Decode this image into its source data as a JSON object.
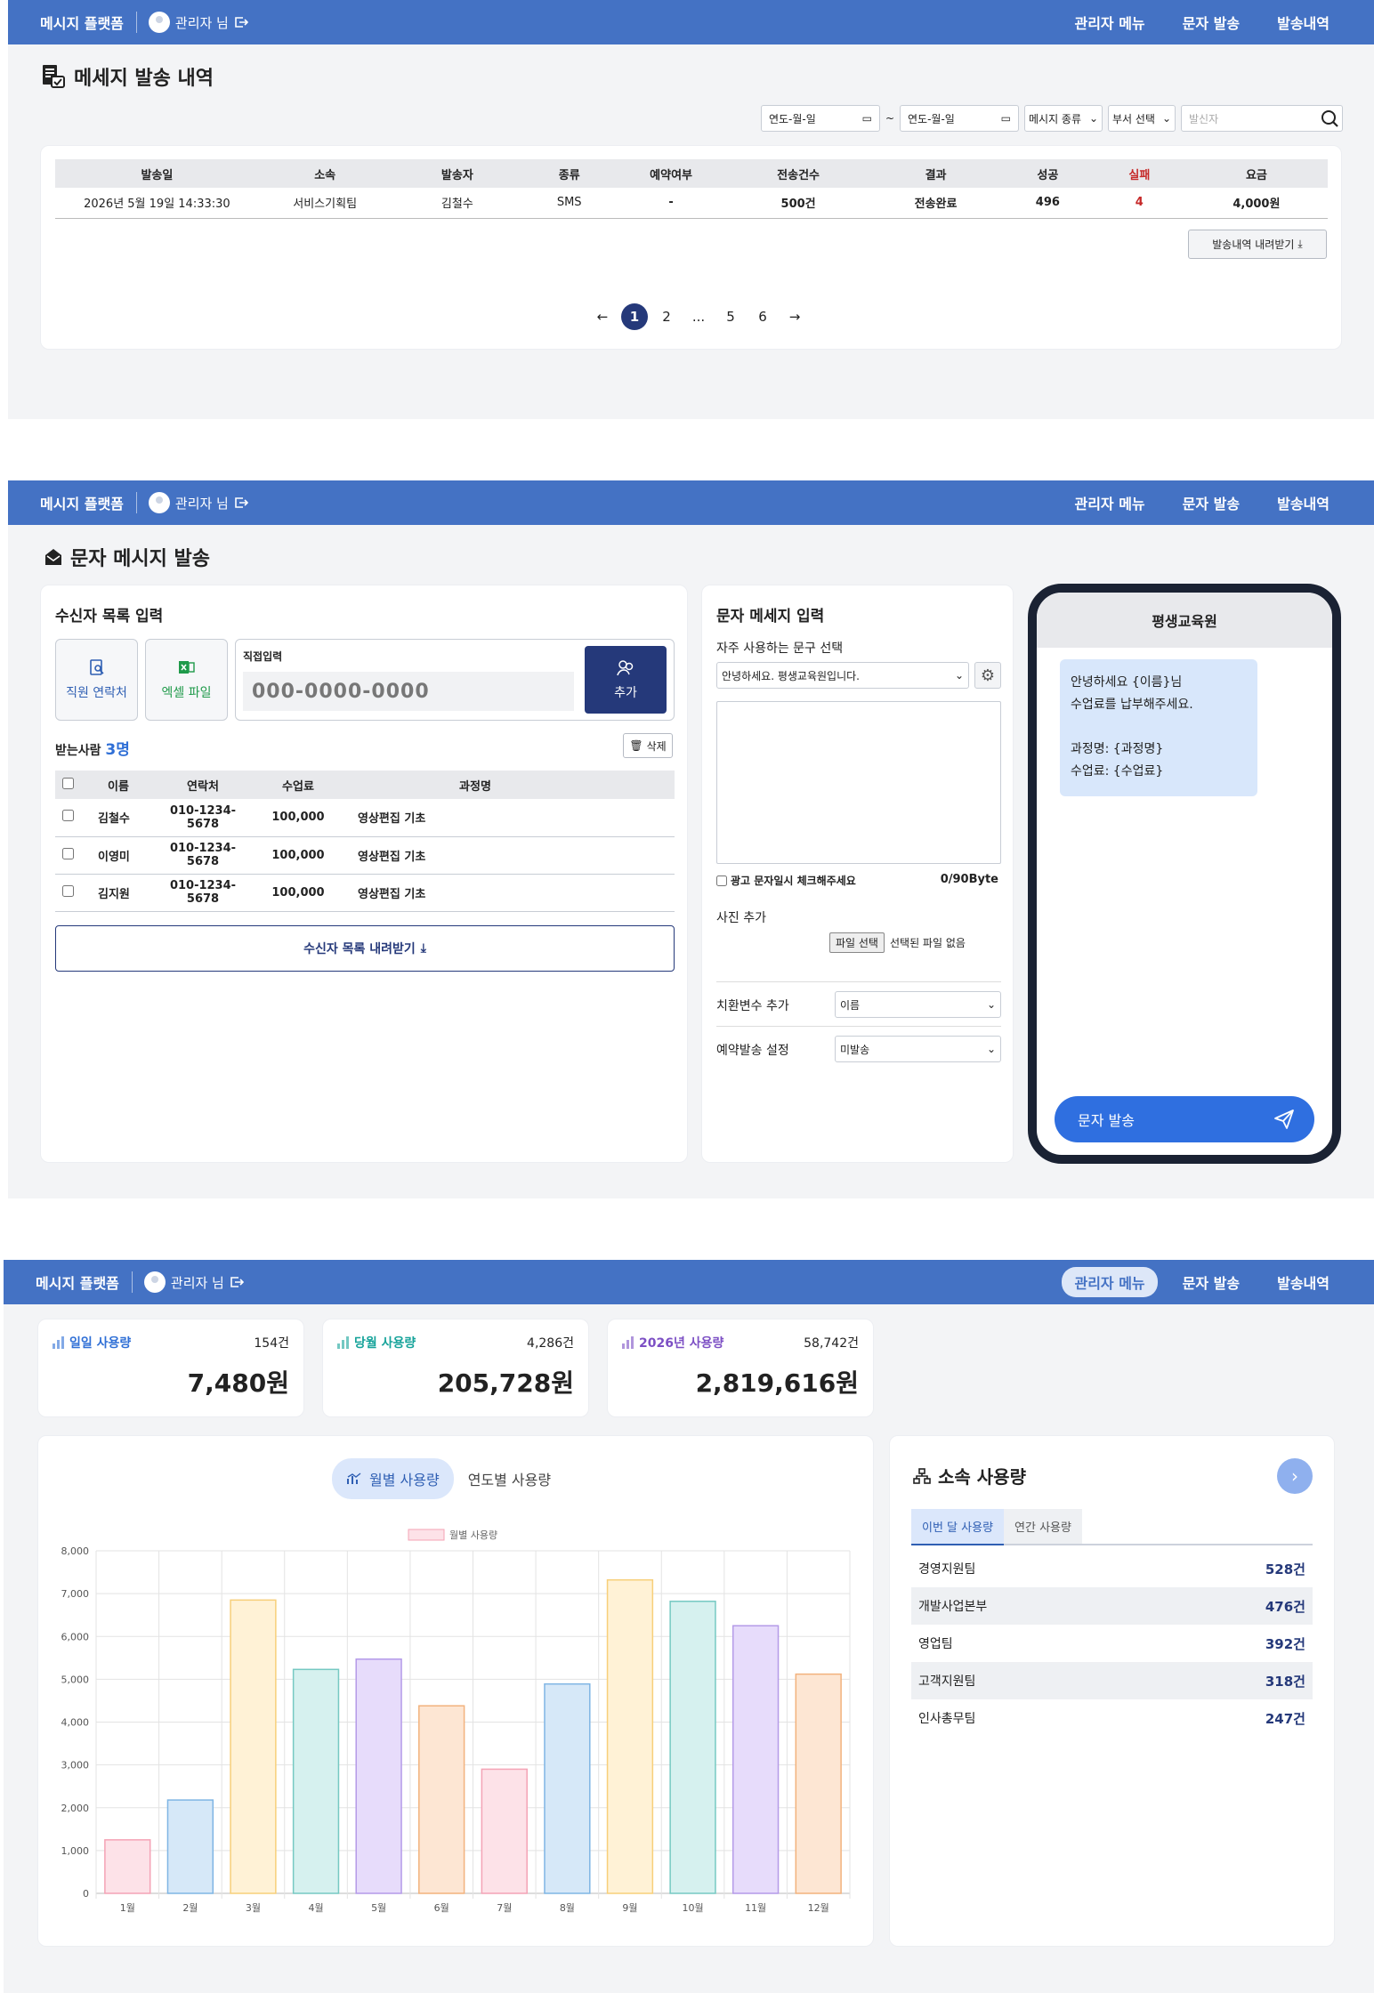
{
  "nav": {
    "logo": "메시지 플랫폼",
    "user": "관리자 님",
    "menu": [
      "관리자 메뉴",
      "문자 발송",
      "발송내역"
    ]
  },
  "history": {
    "title": "메세지 발송 내역",
    "filter": {
      "date_from": "연도-월-일",
      "tilde": "~",
      "date_to": "연도-월-일",
      "type_select": "메시지 종류",
      "dept_select": "부서 선택",
      "sender_placeholder": "발신자"
    },
    "columns": [
      "발송일",
      "소속",
      "발송자",
      "종류",
      "예약여부",
      "전송건수",
      "결과",
      "성공",
      "실패",
      "요금"
    ],
    "rows": [
      [
        "2026년 5월 19일 14:33:30",
        "서비스기획팀",
        "김철수",
        "SMS",
        "-",
        "500건",
        "전송완료",
        "496",
        "4",
        "4,000원"
      ]
    ],
    "download_label": "발송내역 내려받기",
    "pages": [
      "1",
      "2",
      "...",
      "5",
      "6"
    ]
  },
  "send": {
    "title": "문자 메시지 발송",
    "recipients": {
      "title": "수신자 목록 입력",
      "staff_btn": "직원 연락처",
      "excel_btn": "엑셀 파일",
      "direct_label": "직접입력",
      "direct_placeholder": "000-0000-0000",
      "add_btn": "추가",
      "count_label": "받는사람",
      "count": "3명",
      "delete_btn": "삭제",
      "columns": [
        "이름",
        "연락처",
        "수업료",
        "과정명"
      ],
      "rows": [
        [
          "김철수",
          "010-1234-5678",
          "100,000",
          "영상편집 기초"
        ],
        [
          "이영미",
          "010-1234-5678",
          "100,000",
          "영상편집 기초"
        ],
        [
          "김지원",
          "010-1234-5678",
          "100,000",
          "영상편집 기초"
        ]
      ],
      "download_btn": "수신자 목록 내려받기"
    },
    "message": {
      "title": "문자 메세지 입력",
      "phrase_label": "자주 사용하는 문구 선택",
      "phrase_value": "안녕하세요. 평생교육원입니다.",
      "ad_check": "광고 문자일시 체크해주세요",
      "bytes": "0/90Byte",
      "photo_label": "사진 추가",
      "file_btn": "파일 선택",
      "file_none": "선택된 파일 없음",
      "var_label": "치환변수 추가",
      "var_value": "이름",
      "reserve_label": "예약발송 설정",
      "reserve_value": "미발송"
    },
    "phone": {
      "header": "평생교육원",
      "bubble": [
        "안녕하세요 {이름}님",
        "수업료를 납부해주세요.",
        "",
        "과정명: {과정명}",
        "수업료: {수업료}"
      ],
      "send_btn": "문자 발송"
    }
  },
  "dashboard": {
    "stats": [
      {
        "label": "일일 사용량",
        "count": "154건",
        "amount": "7,480원",
        "color": "#2f6fd6"
      },
      {
        "label": "당월 사용량",
        "count": "4,286건",
        "amount": "205,728원",
        "color": "#16a39a"
      },
      {
        "label": "2026년 사용량",
        "count": "58,742건",
        "amount": "2,819,616원",
        "color": "#7c4fc4"
      }
    ],
    "tabs": [
      "월별 사용량",
      "연도별 사용량"
    ],
    "dept": {
      "title": "소속 사용량",
      "tabs": [
        "이번 달 사용량",
        "연간 사용량"
      ],
      "rows": [
        [
          "경영지원팀",
          "528건"
        ],
        [
          "개발사업본부",
          "476건"
        ],
        [
          "영업팀",
          "392건"
        ],
        [
          "고객지원팀",
          "318건"
        ],
        [
          "인사총무팀",
          "247건"
        ]
      ]
    }
  },
  "chart_data": {
    "type": "bar",
    "legend": "월별 사용량",
    "categories": [
      "1월",
      "2월",
      "3월",
      "4월",
      "5월",
      "6월",
      "7월",
      "8월",
      "9월",
      "10월",
      "11월",
      "12월"
    ],
    "series": [
      {
        "name": "월별 사용량",
        "values": [
          1250,
          2180,
          6850,
          5230,
          5470,
          4380,
          2900,
          4890,
          7320,
          6820,
          6250,
          5120
        ]
      }
    ],
    "ylim": [
      0,
      8000
    ],
    "yticks": [
      "0",
      "1,000",
      "2,000",
      "3,000",
      "4,000",
      "5,000",
      "6,000",
      "7,000",
      "8,000"
    ],
    "grid": true,
    "legend_position": "top",
    "colors": [
      [
        "#fde2e8",
        "#f4a3b5"
      ],
      [
        "#d6e8f8",
        "#7fb5e4"
      ],
      [
        "#fff2d6",
        "#f7cf7a"
      ],
      [
        "#d6f1ef",
        "#76c9c2"
      ],
      [
        "#e7dcfb",
        "#b49ae8"
      ],
      [
        "#fde6d3",
        "#f2b27d"
      ],
      [
        "#fde2e8",
        "#f4a3b5"
      ],
      [
        "#d6e8f8",
        "#7fb5e4"
      ],
      [
        "#fff2d6",
        "#f7cf7a"
      ],
      [
        "#d6f1ef",
        "#76c9c2"
      ],
      [
        "#e7dcfb",
        "#b49ae8"
      ],
      [
        "#fde6d3",
        "#f2b27d"
      ]
    ]
  }
}
